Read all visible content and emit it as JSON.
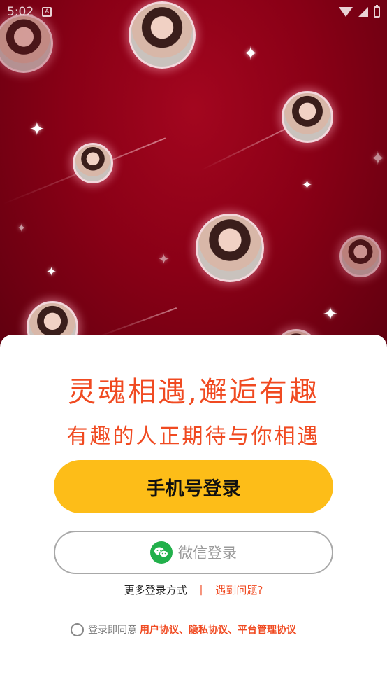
{
  "status_bar": {
    "time": "5:02"
  },
  "hero": {
    "icons": [
      "avatar",
      "sparkle-icon",
      "meteor-streak"
    ]
  },
  "slogan": {
    "line1": "灵魂相遇,邂逅有趣",
    "line2": "有趣的人正期待与你相遇"
  },
  "buttons": {
    "phone_login": "手机号登录",
    "wechat_login": "微信登录"
  },
  "links": {
    "more_login": "更多登录方式",
    "separator": "|",
    "problem": "遇到问题?"
  },
  "agreement": {
    "prefix": "登录即同意",
    "links": "用户协议、隐私协议、平台管理协议"
  },
  "colors": {
    "accent": "#f04a21",
    "primary_button": "#fdbd18",
    "hero_bg": "#8a0016",
    "wechat_green": "#22b04b"
  }
}
